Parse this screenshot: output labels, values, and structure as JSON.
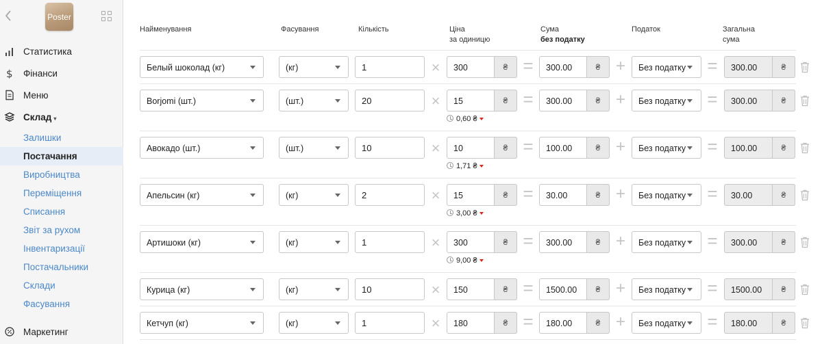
{
  "sidebar": {
    "logo_text": "Poster",
    "nav": [
      {
        "label": "Статистика",
        "icon": "bar-chart-icon"
      },
      {
        "label": "Фінанси",
        "icon": "dollar-icon"
      },
      {
        "label": "Меню",
        "icon": "document-icon"
      },
      {
        "label": "Склад",
        "icon": "layers-icon",
        "caret": "▾"
      },
      {
        "label": "Маркетинг",
        "icon": "percent-badge-icon"
      }
    ],
    "sub_items": [
      {
        "label": "Залишки",
        "active": false
      },
      {
        "label": "Постачання",
        "active": true
      },
      {
        "label": "Виробництва",
        "active": false
      },
      {
        "label": "Переміщення",
        "active": false
      },
      {
        "label": "Списання",
        "active": false
      },
      {
        "label": "Звіт за рухом",
        "active": false
      },
      {
        "label": "Інвентаризації",
        "active": false
      },
      {
        "label": "Постачальники",
        "active": false
      },
      {
        "label": "Склади",
        "active": false
      },
      {
        "label": "Фасування",
        "active": false
      }
    ]
  },
  "table": {
    "headers": {
      "name": "Найменування",
      "packing": "Фасування",
      "quantity": "Кількість",
      "price_line1": "Ціна",
      "price_line2": "за одиницю",
      "sum_line1": "Сума",
      "sum_line2": "без податку",
      "tax": "Податок",
      "total_line1": "Загальна",
      "total_line2": "сума"
    },
    "currency": "₴",
    "rows": [
      {
        "name": "Белый шоколад (кг)",
        "packing": "(кг)",
        "qty": "1",
        "price": "300",
        "sum": "300.00",
        "tax": "Без податку",
        "total": "300.00",
        "hint": ""
      },
      {
        "name": "Borjomi (шт.)",
        "packing": "(шт.)",
        "qty": "20",
        "price": "15",
        "sum": "300.00",
        "tax": "Без податку",
        "total": "300.00",
        "hint": "0,60 ₴"
      },
      {
        "name": "Авокадо (шт.)",
        "packing": "(шт.)",
        "qty": "10",
        "price": "10",
        "sum": "100.00",
        "tax": "Без податку",
        "total": "100.00",
        "hint": "1,71 ₴"
      },
      {
        "name": "Апельсин (кг)",
        "packing": "(кг)",
        "qty": "2",
        "price": "15",
        "sum": "30.00",
        "tax": "Без податку",
        "total": "30.00",
        "hint": "3,00 ₴"
      },
      {
        "name": "Артишоки (кг)",
        "packing": "(кг)",
        "qty": "1",
        "price": "300",
        "sum": "300.00",
        "tax": "Без податку",
        "total": "300.00",
        "hint": "9,00 ₴"
      },
      {
        "name": "Курица (кг)",
        "packing": "(кг)",
        "qty": "10",
        "price": "150",
        "sum": "1500.00",
        "tax": "Без податку",
        "total": "1500.00",
        "hint": ""
      },
      {
        "name": "Кетчуп (кг)",
        "packing": "(кг)",
        "qty": "1",
        "price": "180",
        "sum": "180.00",
        "tax": "Без податку",
        "total": "180.00",
        "hint": ""
      }
    ]
  },
  "colors": {
    "accent_link": "#4a88c9",
    "active_bg": "#e6edf6",
    "price_down": "#d9231e"
  }
}
